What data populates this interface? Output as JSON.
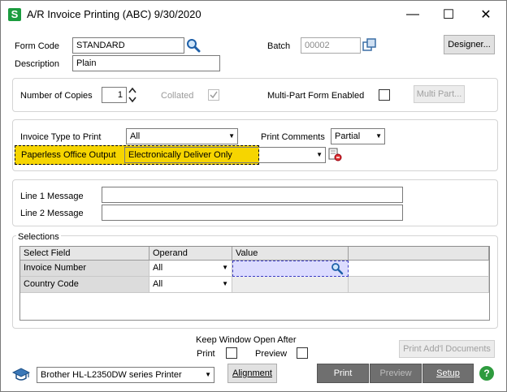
{
  "window": {
    "app_icon_letter": "S",
    "title": "A/R Invoice Printing (ABC) 9/30/2020",
    "minimize_glyph": "—",
    "maximize_glyph": "☐",
    "close_glyph": "✕"
  },
  "header": {
    "form_code_label": "Form Code",
    "form_code_value": "STANDARD",
    "description_label": "Description",
    "description_value": "Plain",
    "batch_label": "Batch",
    "batch_value": "00002",
    "designer_label": "Designer..."
  },
  "copies": {
    "number_of_copies_label": "Number of Copies",
    "number_of_copies_value": "1",
    "collated_label": "Collated",
    "collated_checked": true,
    "multipart_label": "Multi-Part Form Enabled",
    "multipart_checked": false,
    "multipart_button": "Multi Part..."
  },
  "options": {
    "invoice_type_label": "Invoice Type to Print",
    "invoice_type_value": "All",
    "print_comments_label": "Print Comments",
    "print_comments_value": "Partial",
    "paperless_label": "Paperless Office Output",
    "paperless_value": "Electronically Deliver Only"
  },
  "messages": {
    "line1_label": "Line 1 Message",
    "line1_value": "",
    "line2_label": "Line 2 Message",
    "line2_value": ""
  },
  "selections": {
    "title": "Selections",
    "columns": [
      "Select Field",
      "Operand",
      "Value"
    ],
    "rows": [
      {
        "field": "Invoice Number",
        "operand": "All",
        "value": ""
      },
      {
        "field": "Country Code",
        "operand": "All",
        "value": ""
      }
    ]
  },
  "footer": {
    "keep_open_label": "Keep Window Open After",
    "print_label": "Print",
    "preview_label": "Preview",
    "print_addl_docs": "Print Add'l Documents",
    "printer_value": "Brother HL-L2350DW series Printer",
    "alignment_label": "Alignment",
    "print_button": "Print",
    "preview_button": "Preview",
    "setup_button": "Setup",
    "help_glyph": "?"
  },
  "colors": {
    "highlight": "#f6d500",
    "brand_green": "#1b9c3f",
    "selected_cell": "#dcdcff"
  }
}
